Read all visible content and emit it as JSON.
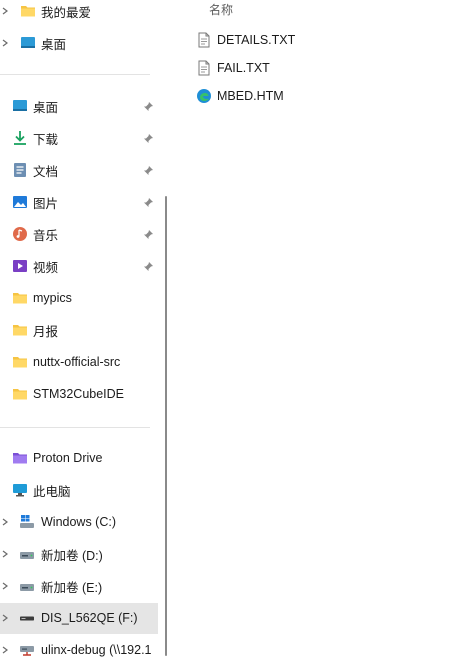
{
  "nav": {
    "items": [
      {
        "label": "我的最爱",
        "icon": "folder-icon",
        "chevron": true,
        "pin": false
      },
      {
        "label": "桌面",
        "icon": "desktop-icon",
        "chevron": true,
        "pin": false
      },
      {
        "label": "桌面",
        "icon": "desktop-icon",
        "chevron": false,
        "pin": true
      },
      {
        "label": "下载",
        "icon": "download-icon",
        "chevron": false,
        "pin": true
      },
      {
        "label": "文档",
        "icon": "document-icon",
        "chevron": false,
        "pin": true
      },
      {
        "label": "图片",
        "icon": "pictures-icon",
        "chevron": false,
        "pin": true
      },
      {
        "label": "音乐",
        "icon": "music-icon",
        "chevron": false,
        "pin": true
      },
      {
        "label": "视频",
        "icon": "video-icon",
        "chevron": false,
        "pin": true
      },
      {
        "label": "mypics",
        "icon": "folder-icon",
        "chevron": false,
        "pin": false
      },
      {
        "label": "月报",
        "icon": "folder-icon",
        "chevron": false,
        "pin": false
      },
      {
        "label": "nuttx-official-src",
        "icon": "folder-icon",
        "chevron": false,
        "pin": false
      },
      {
        "label": "STM32CubeIDE",
        "icon": "folder-icon",
        "chevron": false,
        "pin": false
      },
      {
        "label": "Proton Drive",
        "icon": "proton-drive-icon",
        "chevron": false,
        "pin": false
      },
      {
        "label": "此电脑",
        "icon": "computer-icon",
        "chevron": false,
        "pin": false
      },
      {
        "label": "Windows  (C:)",
        "icon": "windows-drive-icon",
        "chevron": true,
        "pin": false
      },
      {
        "label": "新加卷 (D:)",
        "icon": "drive-icon",
        "chevron": true,
        "pin": false
      },
      {
        "label": "新加卷 (E:)",
        "icon": "drive-icon",
        "chevron": true,
        "pin": false
      },
      {
        "label": "DIS_L562QE (F:)",
        "icon": "usb-drive-icon",
        "chevron": true,
        "pin": false,
        "selected": true
      },
      {
        "label": "ulinx-debug (\\\\192.1",
        "icon": "network-drive-icon",
        "chevron": true,
        "pin": false
      }
    ]
  },
  "content": {
    "column_header": "名称",
    "files": [
      {
        "name": "DETAILS.TXT",
        "icon": "text-file-icon"
      },
      {
        "name": "FAIL.TXT",
        "icon": "text-file-icon"
      },
      {
        "name": "MBED.HTM",
        "icon": "edge-html-icon"
      }
    ]
  },
  "colors": {
    "folder": "#f6c443",
    "selection": "#e5e5e5",
    "accent": "#0078d4"
  }
}
